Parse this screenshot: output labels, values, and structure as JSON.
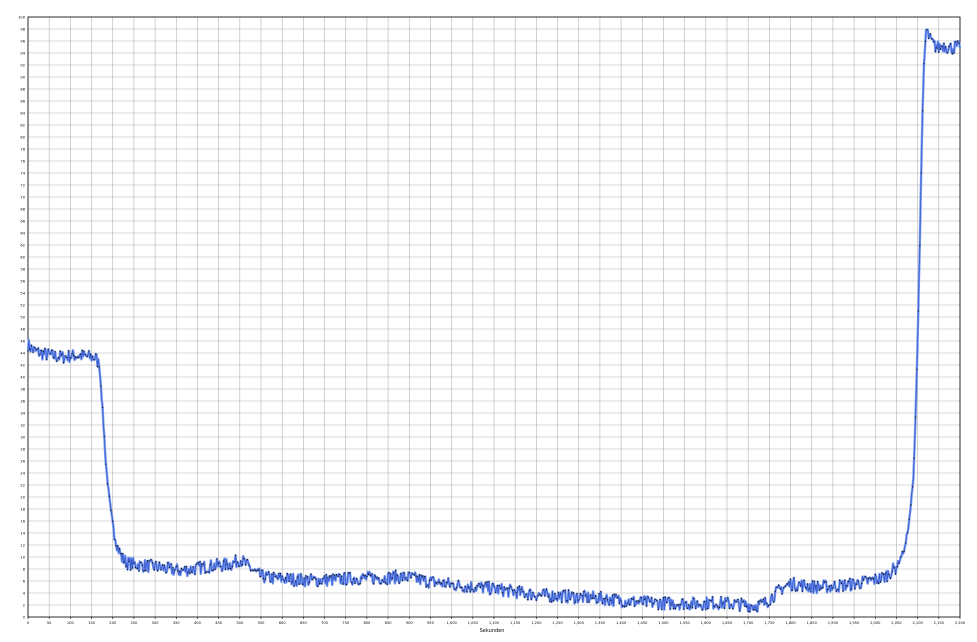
{
  "chart_data": {
    "type": "scatter",
    "title": "",
    "xlabel": "Sekunden",
    "ylabel": "",
    "xlim": [
      0,
      2200
    ],
    "ylim": [
      0,
      100
    ],
    "x_tick_step": 50,
    "x_tick_label_every": 1,
    "grid": true,
    "legend": "none",
    "colors": {
      "line": "#3355cc",
      "fill": "#7799ee",
      "marker": "#111111",
      "grid": "#b4b4b4",
      "axis": "#000000"
    },
    "series": [
      {
        "x": [
          0,
          10,
          20,
          40,
          60,
          80,
          100,
          120,
          140,
          160,
          168,
          172,
          176,
          180,
          184,
          190,
          196,
          204,
          212,
          222,
          235,
          250,
          270,
          300,
          330,
          360,
          390,
          420,
          450,
          480,
          500,
          510,
          520,
          535,
          550,
          570,
          600,
          640,
          680,
          720,
          760,
          800,
          840,
          870,
          900,
          940,
          980,
          1020,
          1060,
          1100,
          1140,
          1180,
          1220,
          1260,
          1300,
          1340,
          1380,
          1420,
          1460,
          1500,
          1540,
          1580,
          1620,
          1660,
          1700,
          1720,
          1740,
          1760,
          1780,
          1800,
          1820,
          1860,
          1900,
          1940,
          1980,
          2020,
          2050,
          2070,
          2080,
          2090,
          2095,
          2100,
          2105,
          2110,
          2115,
          2120,
          2130,
          2140,
          2150,
          2160,
          2170,
          2180,
          2190,
          2200
        ],
        "y": [
          45.4,
          44.6,
          44.2,
          43.8,
          43.5,
          43.3,
          43.5,
          43.6,
          43.4,
          43.2,
          42.0,
          38.8,
          34.5,
          30.0,
          25.5,
          21.0,
          17.5,
          14.0,
          11.6,
          9.8,
          9.0,
          8.8,
          8.6,
          8.4,
          8.0,
          7.7,
          8.0,
          8.4,
          8.6,
          8.8,
          9.6,
          9.1,
          8.4,
          7.5,
          6.8,
          6.5,
          6.4,
          6.2,
          6.1,
          6.2,
          6.4,
          6.5,
          6.5,
          6.7,
          6.6,
          6.0,
          5.6,
          5.2,
          5.0,
          4.7,
          4.3,
          3.9,
          3.6,
          3.5,
          3.3,
          3.2,
          2.9,
          2.6,
          2.4,
          2.3,
          2.3,
          2.2,
          2.4,
          2.2,
          2.0,
          1.9,
          2.3,
          3.6,
          4.8,
          5.5,
          5.4,
          5.0,
          5.1,
          5.4,
          5.9,
          6.6,
          8.3,
          11.5,
          16.0,
          23.0,
          33.0,
          46.0,
          62.0,
          80.0,
          92.0,
          97.8,
          96.2,
          95.2,
          94.9,
          95.3,
          95.0,
          94.8,
          95.1,
          94.8
        ]
      }
    ]
  }
}
